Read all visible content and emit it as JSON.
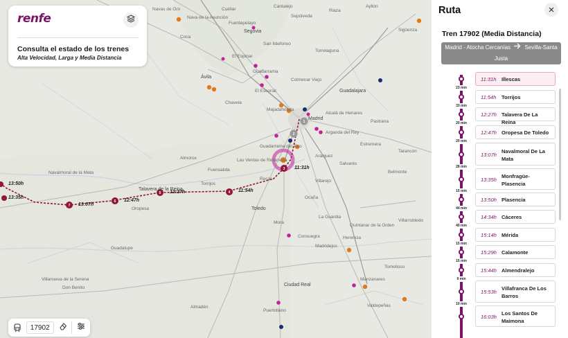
{
  "brand": {
    "logo": "renfe",
    "title": "Consulta el estado de los trenes",
    "subtitle": "Alta Velocidad, Larga y Media Distancia"
  },
  "search": {
    "train_number": "17902"
  },
  "map": {
    "train_times": [
      "13:50h",
      "13:35h",
      "13:07h",
      "12:47h",
      "12:27h",
      "11:54h",
      "11:31h"
    ],
    "route_stop_numbers": [
      "1",
      "2",
      "3",
      "4",
      "5",
      "6",
      "7"
    ],
    "place_labels": [
      "Nava de la Asunción",
      "Cuéllar",
      "Cantalejo",
      "Coca",
      "Fuentepelayo",
      "Riaza",
      "Sepúlveda",
      "Ayllón",
      "Navas de Oro",
      "Sigüenza",
      "Segovia",
      "San Ildefonso",
      "El Espinar",
      "Guadarrama",
      "Torrelaguna",
      "Ávila",
      "Colmenar Viejo",
      "El Escorial",
      "Guadalajara",
      "Chavela",
      "Majadahonda",
      "Alcalá de Henares",
      "Madrid",
      "Pastrana",
      "Arganda del Rey",
      "Guadarrama del Tajo",
      "Estremera",
      "Tarancón",
      "Las Ventas de Retamosa",
      "Fuensalida",
      "Aranjuez",
      "Salvarés",
      "Belmonte",
      "Recas",
      "Villarejo",
      "Ocaña",
      "Talavera de la Reina",
      "Toledo",
      "Oropesa",
      "Torrijos",
      "Navalmoral de la Mata",
      "Mora",
      "Quintanar de la Orden",
      "La Guardia",
      "Madridejos",
      "Almorox",
      "Guadalupe",
      "Consuegra",
      "Herencia",
      "Manzanares",
      "Valdepeñas",
      "Ciudad Real",
      "Puertollano",
      "Villanueva de la Serena",
      "Don Benito",
      "Tomelloso",
      "Villarrobledo",
      "Almadén"
    ]
  },
  "panel": {
    "title": "Ruta",
    "train_title": "Tren 17902 (Media Distancia)",
    "route_from": "Madrid - Atocha Cercanías",
    "route_to": "Sevilla-Santa Justa",
    "stops": [
      {
        "time": "11:31h",
        "name": "Illescas",
        "active": true
      },
      {
        "time": "11:54h",
        "name": "Torrijos"
      },
      {
        "time": "12:27h",
        "name": "Talavera De La Reina"
      },
      {
        "time": "12:47h",
        "name": "Oropesa De Toledo"
      },
      {
        "time": "13:07h",
        "name": "Navalmoral De La Mata"
      },
      {
        "time": "13:35h",
        "name": "Monfragüe-Plasencia"
      },
      {
        "time": "13:50h",
        "name": "Plasencia"
      },
      {
        "time": "14:34h",
        "name": "Cáceres"
      },
      {
        "time": "15:14h",
        "name": "Mérida"
      },
      {
        "time": "15:29h",
        "name": "Calamonte"
      },
      {
        "time": "15:44h",
        "name": "Almendralejo"
      },
      {
        "time": "15:53h",
        "name": "Villafranca De Los Barros"
      },
      {
        "time": "16:03h",
        "name": "Los Santos De Maimona"
      }
    ],
    "durations": [
      "23 min",
      "33 min",
      "20 min",
      "20 min",
      "28 min",
      "15 min",
      "44 min",
      "40 min",
      "15 min",
      "15 min",
      "9 min",
      "10 min"
    ]
  },
  "colors": {
    "brand": "#7b1467",
    "route_line": "#8f1539",
    "station_magenta": "#c3209b",
    "station_orange": "#e07a1a",
    "station_navy": "#1b2b6b",
    "active_stop_bg": "#fdeef1",
    "route_box": "#8a8a8a"
  },
  "icons": {
    "layers": "layers-icon",
    "close": "close-icon",
    "train": "train-icon",
    "eraser": "eraser-icon",
    "filter": "filter-icon",
    "arrow": "arrow-right-icon"
  }
}
